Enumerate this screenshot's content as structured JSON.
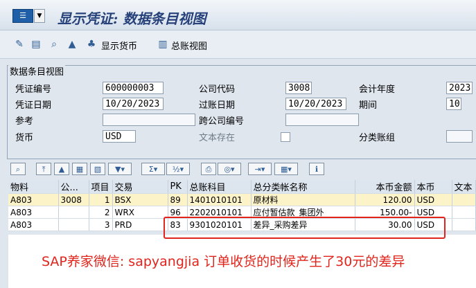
{
  "window": {
    "title": "显示凭证: 数据条目视图"
  },
  "toolbar": {
    "display_currency_label": "显示货币",
    "gl_view_label": "总账视图"
  },
  "panel": {
    "title": "数据条目视图",
    "fields": {
      "doc_no_label": "凭证编号",
      "doc_no_value": "600000003",
      "company_code_label": "公司代码",
      "company_code_value": "3008",
      "fiscal_year_label": "会计年度",
      "fiscal_year_value": "2023",
      "doc_date_label": "凭证日期",
      "doc_date_value": "10/20/2023",
      "posting_date_label": "过账日期",
      "posting_date_value": "10/20/2023",
      "period_label": "期间",
      "period_value": "10",
      "reference_label": "参考",
      "reference_value": "",
      "cross_company_label": "跨公司编号",
      "cross_company_value": "",
      "currency_label": "货币",
      "currency_value": "USD",
      "text_exists_label": "文本存在",
      "ledger_group_label": "分类账组",
      "ledger_group_value": ""
    }
  },
  "grid": {
    "headers": [
      "物料",
      "公...",
      "项目",
      "交易",
      "PK",
      "总账科目",
      "总分类帐名称",
      "本币金额",
      "本币",
      "文本"
    ],
    "rows": [
      [
        "A803",
        "3008",
        "1",
        "BSX",
        "89",
        "1401010101",
        "原材料",
        "120.00",
        "USD",
        ""
      ],
      [
        "A803",
        "",
        "2",
        "WRX",
        "96",
        "2202010101",
        "应付暂估款_集团外",
        "150.00-",
        "USD",
        ""
      ],
      [
        "A803",
        "",
        "3",
        "PRD",
        "83",
        "9301020101",
        "差异_采购差异",
        "30.00",
        "USD",
        ""
      ]
    ]
  },
  "annotation": {
    "text": "SAP养家微信:  sapyangjia  订单收货的时候产生了30元的差异",
    "color": "#e0241b"
  }
}
